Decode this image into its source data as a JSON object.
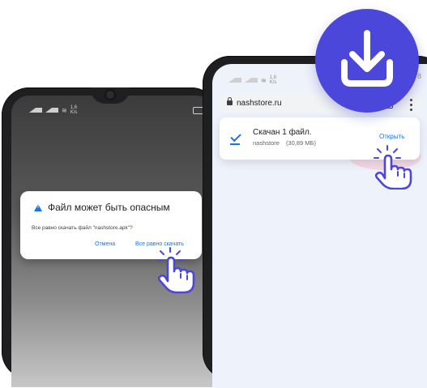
{
  "colors": {
    "accent": "#4b47db",
    "link": "#1a73e8",
    "phone_body": "#1f1f21"
  },
  "left_phone": {
    "status": {
      "speed_value": "1,6",
      "speed_unit": "K/s"
    },
    "dialog": {
      "icon": "warning-icon",
      "title": "Файл может быть опасным",
      "message": "Все равно скачать файл \"nashstore.apk\"?",
      "cancel_label": "Отмена",
      "confirm_label": "Все равно скачать"
    }
  },
  "right_phone": {
    "status": {
      "speed_value": "1,6",
      "speed_unit": "K/s",
      "battery_digit": "8"
    },
    "browser": {
      "url": "nashstore.ru",
      "lock_icon": "lock-icon",
      "menu_icon": "kebab-menu-icon"
    },
    "download": {
      "icon": "download-done-icon",
      "title": "Скачан 1 файл.",
      "source": "nashstore",
      "size": "(30,89 МБ)",
      "open_label": "Открыть"
    }
  },
  "badge": {
    "icon": "download-icon"
  },
  "hands": {
    "icon": "tap-hand-icon"
  }
}
